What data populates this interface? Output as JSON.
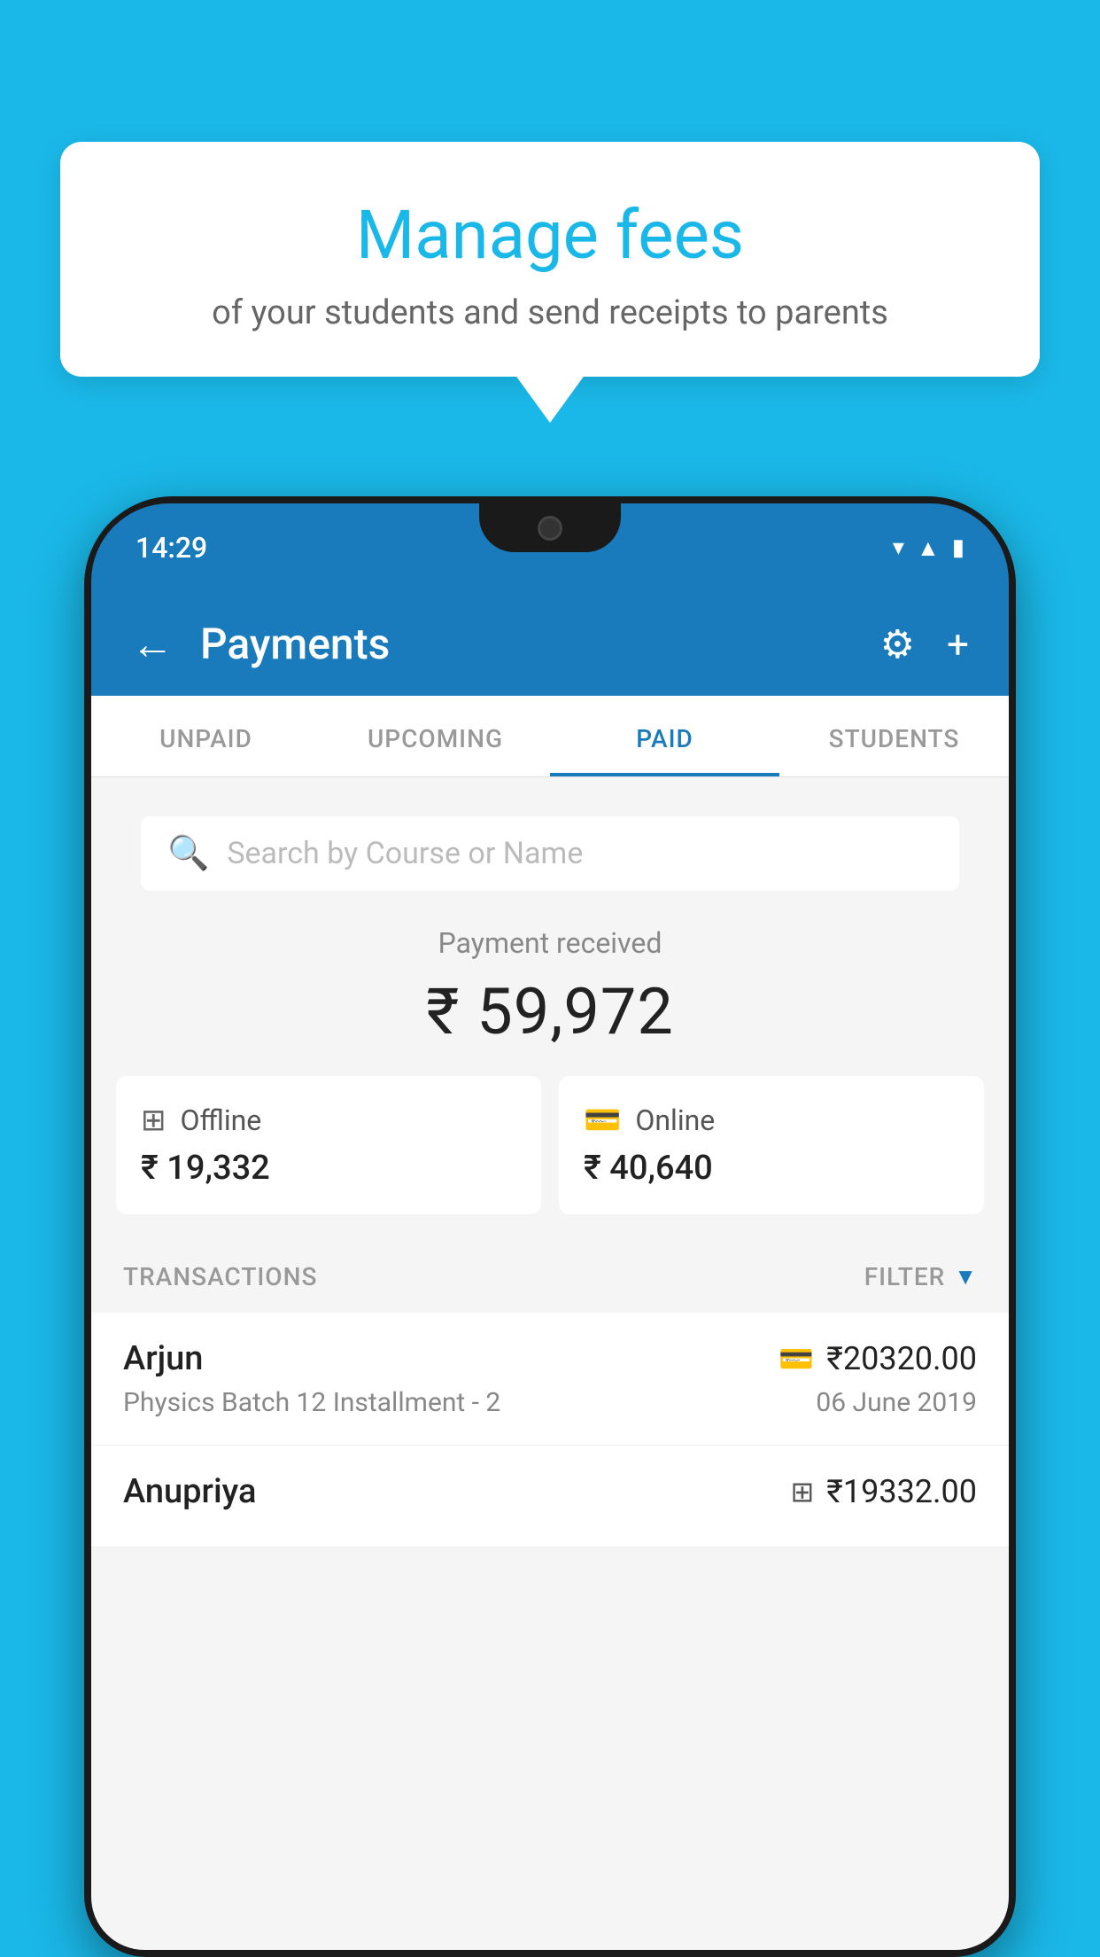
{
  "background_color": "#1ab8e8",
  "tooltip": {
    "title": "Manage fees",
    "subtitle": "of your students and send receipts to parents"
  },
  "phone": {
    "status_time": "14:29",
    "status_icons": [
      "wifi",
      "signal",
      "battery"
    ]
  },
  "header": {
    "title": "Payments",
    "back_label": "←",
    "settings_label": "⚙",
    "add_label": "+"
  },
  "tabs": [
    {
      "label": "UNPAID",
      "active": false
    },
    {
      "label": "UPCOMING",
      "active": false
    },
    {
      "label": "PAID",
      "active": true
    },
    {
      "label": "STUDENTS",
      "active": false
    }
  ],
  "search": {
    "placeholder": "Search by Course or Name"
  },
  "payment_summary": {
    "received_label": "Payment received",
    "amount": "₹ 59,972",
    "offline_label": "Offline",
    "offline_amount": "₹ 19,332",
    "online_label": "Online",
    "online_amount": "₹ 40,640"
  },
  "transactions": {
    "section_label": "TRANSACTIONS",
    "filter_label": "FILTER",
    "items": [
      {
        "name": "Arjun",
        "course": "Physics Batch 12 Installment - 2",
        "amount": "₹20320.00",
        "date": "06 June 2019",
        "method": "online"
      },
      {
        "name": "Anupriya",
        "course": "",
        "amount": "₹19332.00",
        "date": "",
        "method": "offline"
      }
    ]
  }
}
